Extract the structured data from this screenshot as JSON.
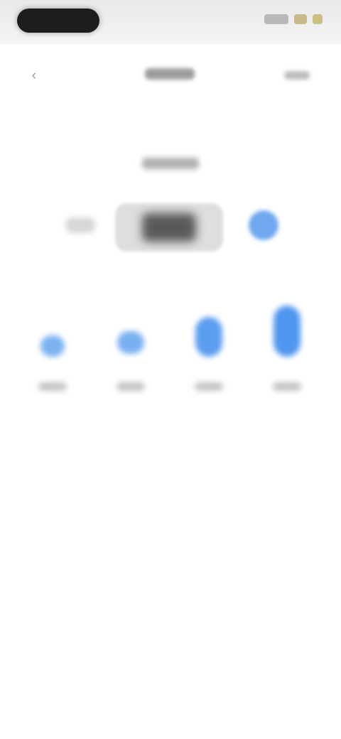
{
  "colors": {
    "accent": "#4f97ef",
    "status_bar": "#e9e9e9",
    "background": "#ffffff"
  },
  "icons": {
    "back": "chevron-left-icon",
    "next": "circle-button-icon"
  },
  "header": {
    "back_glyph": "‹"
  }
}
